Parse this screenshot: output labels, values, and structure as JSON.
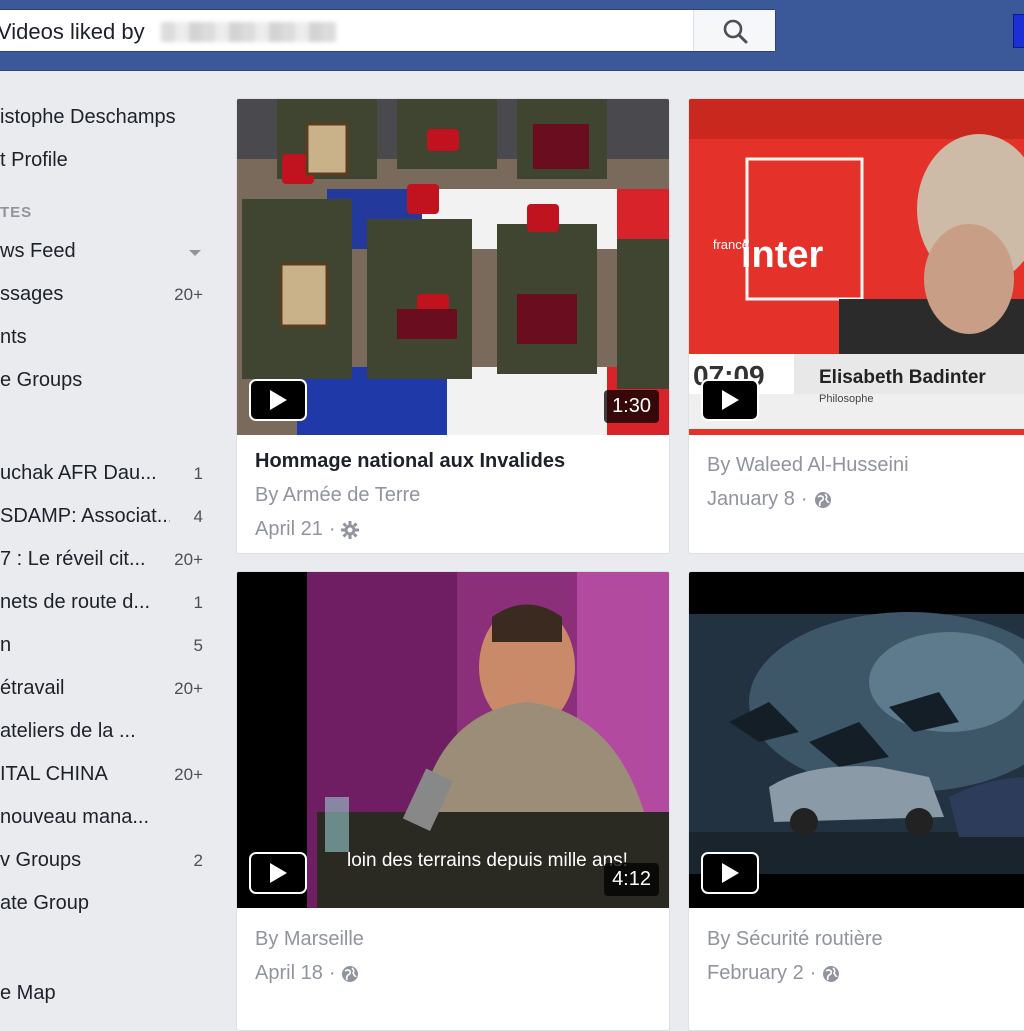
{
  "search": {
    "query": "Videos liked by",
    "placeholder": ""
  },
  "sidebar": {
    "profile_name": "istophe Deschamps",
    "edit_profile": "t Profile",
    "favorites_heading": "TES",
    "items": [
      {
        "label": "ws Feed",
        "count": ""
      },
      {
        "label": "ssages",
        "count": "20+"
      },
      {
        "label": "nts",
        "count": ""
      },
      {
        "label": "e Groups",
        "count": ""
      }
    ],
    "groups": [
      {
        "label": "uchak AFR Dau...",
        "count": "1"
      },
      {
        "label": "SDAMP: Associat...",
        "count": "4"
      },
      {
        "label": "7 : Le réveil cit...",
        "count": "20+"
      },
      {
        "label": "nets de route d...",
        "count": "1"
      },
      {
        "label": "n",
        "count": "5"
      },
      {
        "label": "étravail",
        "count": "20+"
      },
      {
        "label": "ateliers de la ...",
        "count": ""
      },
      {
        "label": "ITAL CHINA",
        "count": "20+"
      },
      {
        "label": "nouveau mana...",
        "count": ""
      },
      {
        "label": "v Groups",
        "count": "2"
      },
      {
        "label": "ate Group",
        "count": ""
      }
    ],
    "map": "e Map"
  },
  "videos": [
    {
      "title": "Hommage national aux Invalides",
      "by": "By Armée de Terre",
      "date": "April 21",
      "privacy": "gear-icon",
      "duration": "1:30"
    },
    {
      "title": "",
      "by": "By Waleed Al-Husseini",
      "date": "January 8",
      "privacy": "globe-icon",
      "duration": ""
    },
    {
      "title": "",
      "by": "By Marseille",
      "date": "April 18",
      "privacy": "globe-icon",
      "duration": "4:12"
    },
    {
      "title": "",
      "by": "By Sécurité routière",
      "date": "February 2",
      "privacy": "globe-icon",
      "duration": ""
    }
  ],
  "thumb_text": {
    "inter_small": "france",
    "inter_logo": "inter",
    "clock": "07:09",
    "guest_name": "Elisabeth Badinter",
    "guest_role": "Philosophe",
    "subtitle": "loin des terrains depuis mille ans!"
  },
  "colors": {
    "topbar": "#3b5998",
    "background": "#e9ebee",
    "meta_text": "#90949c",
    "inter_red": "#e4322b"
  }
}
